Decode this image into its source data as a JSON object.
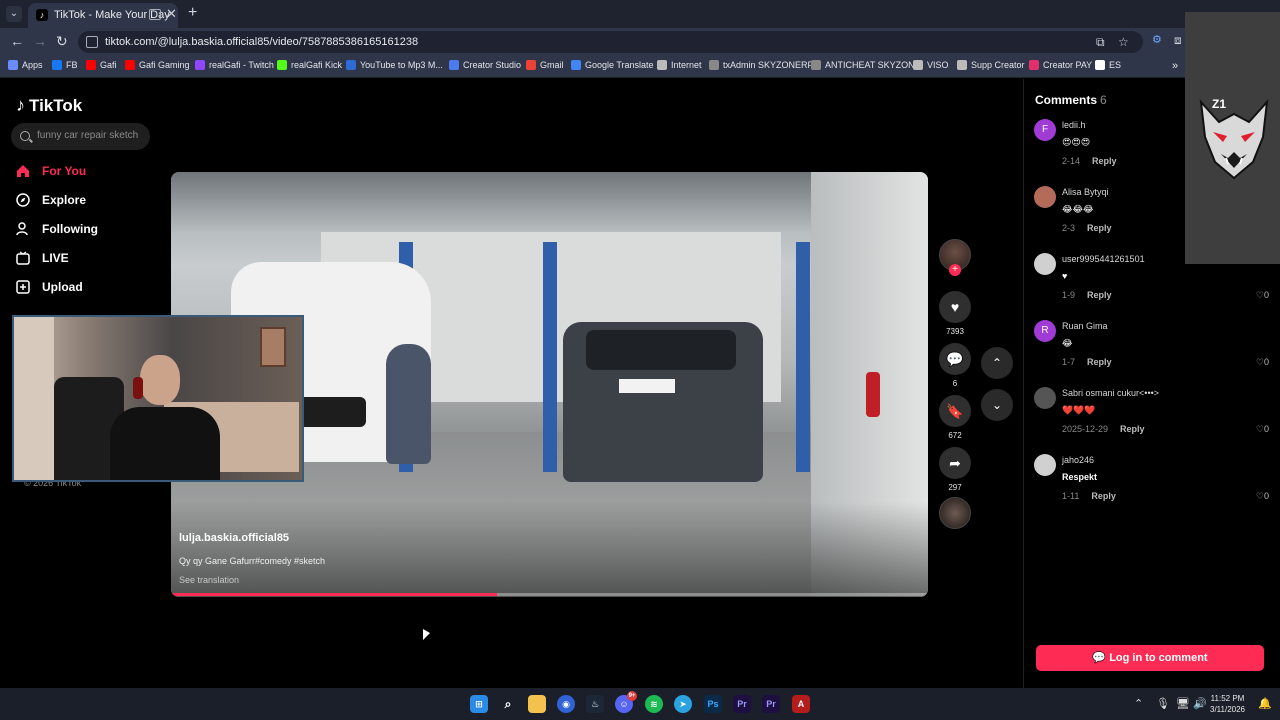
{
  "browser": {
    "tab_title": "TikTok - Make Your Day",
    "url": "tiktok.com/@lulja.baskia.official85/video/7587885386165161238",
    "bookmarks": [
      {
        "label": "Apps",
        "color": "#6a8cff"
      },
      {
        "label": "FB",
        "color": "#1877f2"
      },
      {
        "label": "Gafi",
        "color": "#ff0000"
      },
      {
        "label": "Gafi Gaming",
        "color": "#ff0000"
      },
      {
        "label": "realGafi - Twitch",
        "color": "#9146ff"
      },
      {
        "label": "realGafi Kick",
        "color": "#53fc18"
      },
      {
        "label": "YouTube to Mp3 M...",
        "color": "#2e6bd6"
      },
      {
        "label": "Creator Studio",
        "color": "#4b7bec"
      },
      {
        "label": "Gmail",
        "color": "#ea4335"
      },
      {
        "label": "Google Translate",
        "color": "#4285f4"
      },
      {
        "label": "Internet",
        "color": "#bbbbbb"
      },
      {
        "label": "txAdmin SKYZONERP",
        "color": "#888888"
      },
      {
        "label": "ANTICHEAT SKYZONE",
        "color": "#888888"
      },
      {
        "label": "VISO",
        "color": "#bbbbbb"
      },
      {
        "label": "Supp Creator",
        "color": "#bbbbbb"
      },
      {
        "label": "Creator PAY",
        "color": "#e1306c"
      },
      {
        "label": "ES",
        "color": "#ffffff"
      }
    ]
  },
  "tiktok": {
    "logo": "TikTok",
    "search_placeholder": "funny car repair sketch",
    "nav": [
      {
        "label": "For You",
        "icon": "home-icon",
        "active": true
      },
      {
        "label": "Explore",
        "icon": "compass-icon",
        "active": false
      },
      {
        "label": "Following",
        "icon": "user-icon",
        "active": false
      },
      {
        "label": "LIVE",
        "icon": "live-icon",
        "active": false
      },
      {
        "label": "Upload",
        "icon": "plus-box-icon",
        "active": false
      }
    ],
    "copyright": "© 2026 TikTok"
  },
  "video": {
    "username": "lulja.baskia.official85",
    "description": "Qy qy Gane Gafurr#comedy #sketch",
    "see_translation": "See translation",
    "progress_fraction": 0.43,
    "likes": "7393",
    "comments": "6",
    "saves": "672",
    "shares": "297"
  },
  "comments": {
    "title": "Comments",
    "count": "6",
    "reply_label": "Reply",
    "items": [
      {
        "name": "ledii.h",
        "avatar_letter": "F",
        "avatar_color": "#a03bd6",
        "text": "😍😍😍",
        "date": "2-14",
        "likes": ""
      },
      {
        "name": "Alisa Bytyqi",
        "avatar_letter": "",
        "avatar_color": "#b56b5a",
        "text": "😂😂😂",
        "date": "2-3",
        "likes": ""
      },
      {
        "name": "user9995441261501",
        "avatar_letter": "",
        "avatar_color": "#d0d0d0",
        "text": "♥",
        "date": "1-9",
        "likes": "0"
      },
      {
        "name": "Ruan Gima",
        "avatar_letter": "R",
        "avatar_color": "#a03bd6",
        "text": "😂",
        "date": "1-7",
        "likes": "0"
      },
      {
        "name": "Sabri osmani cukur<•••>",
        "avatar_letter": "",
        "avatar_color": "#555555",
        "text": "❤️❤️❤️",
        "date": "2025-12-29",
        "likes": "0"
      },
      {
        "name": "jaho246",
        "avatar_letter": "",
        "avatar_color": "#d0d0d0",
        "text": "Respekt",
        "date": "1-11",
        "likes": "0"
      }
    ],
    "login_label": "Log in to comment"
  },
  "overlay": {
    "wolf_label": "Z1"
  },
  "taskbar": {
    "time": "11:52 PM",
    "date": "3/11/2026",
    "discord_badge": "9+"
  },
  "colors": {
    "accent": "#fe2c55"
  }
}
